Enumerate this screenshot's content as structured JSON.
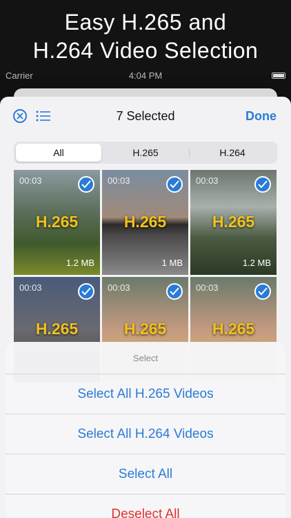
{
  "banner": {
    "line1": "Easy H.265 and",
    "line2": "H.264 Video Selection"
  },
  "status_bar": {
    "carrier": "Carrier",
    "time": "4:04 PM"
  },
  "nav": {
    "title": "7 Selected",
    "done_label": "Done"
  },
  "segments": [
    "All",
    "H.265",
    "H.264"
  ],
  "tiles": [
    {
      "duration": "00:03",
      "codec": "H.265",
      "size": "1.2 MB",
      "selected": true
    },
    {
      "duration": "00:03",
      "codec": "H.265",
      "size": "1 MB",
      "selected": true
    },
    {
      "duration": "00:03",
      "codec": "H.265",
      "size": "1.2 MB",
      "selected": true
    },
    {
      "duration": "00:03",
      "codec": "H.265",
      "size": "",
      "selected": true
    },
    {
      "duration": "00:03",
      "codec": "H.265",
      "size": "",
      "selected": true
    },
    {
      "duration": "00:03",
      "codec": "H.265",
      "size": "",
      "selected": true
    }
  ],
  "action_sheet": {
    "header": "Select",
    "items": [
      "Select All H.265 Videos",
      "Select All H.264 Videos",
      "Select All",
      "Deselect All"
    ]
  },
  "colors": {
    "accent": "#2a7bd6",
    "codec_label": "#f2c21b",
    "destructive": "#e0302a"
  }
}
